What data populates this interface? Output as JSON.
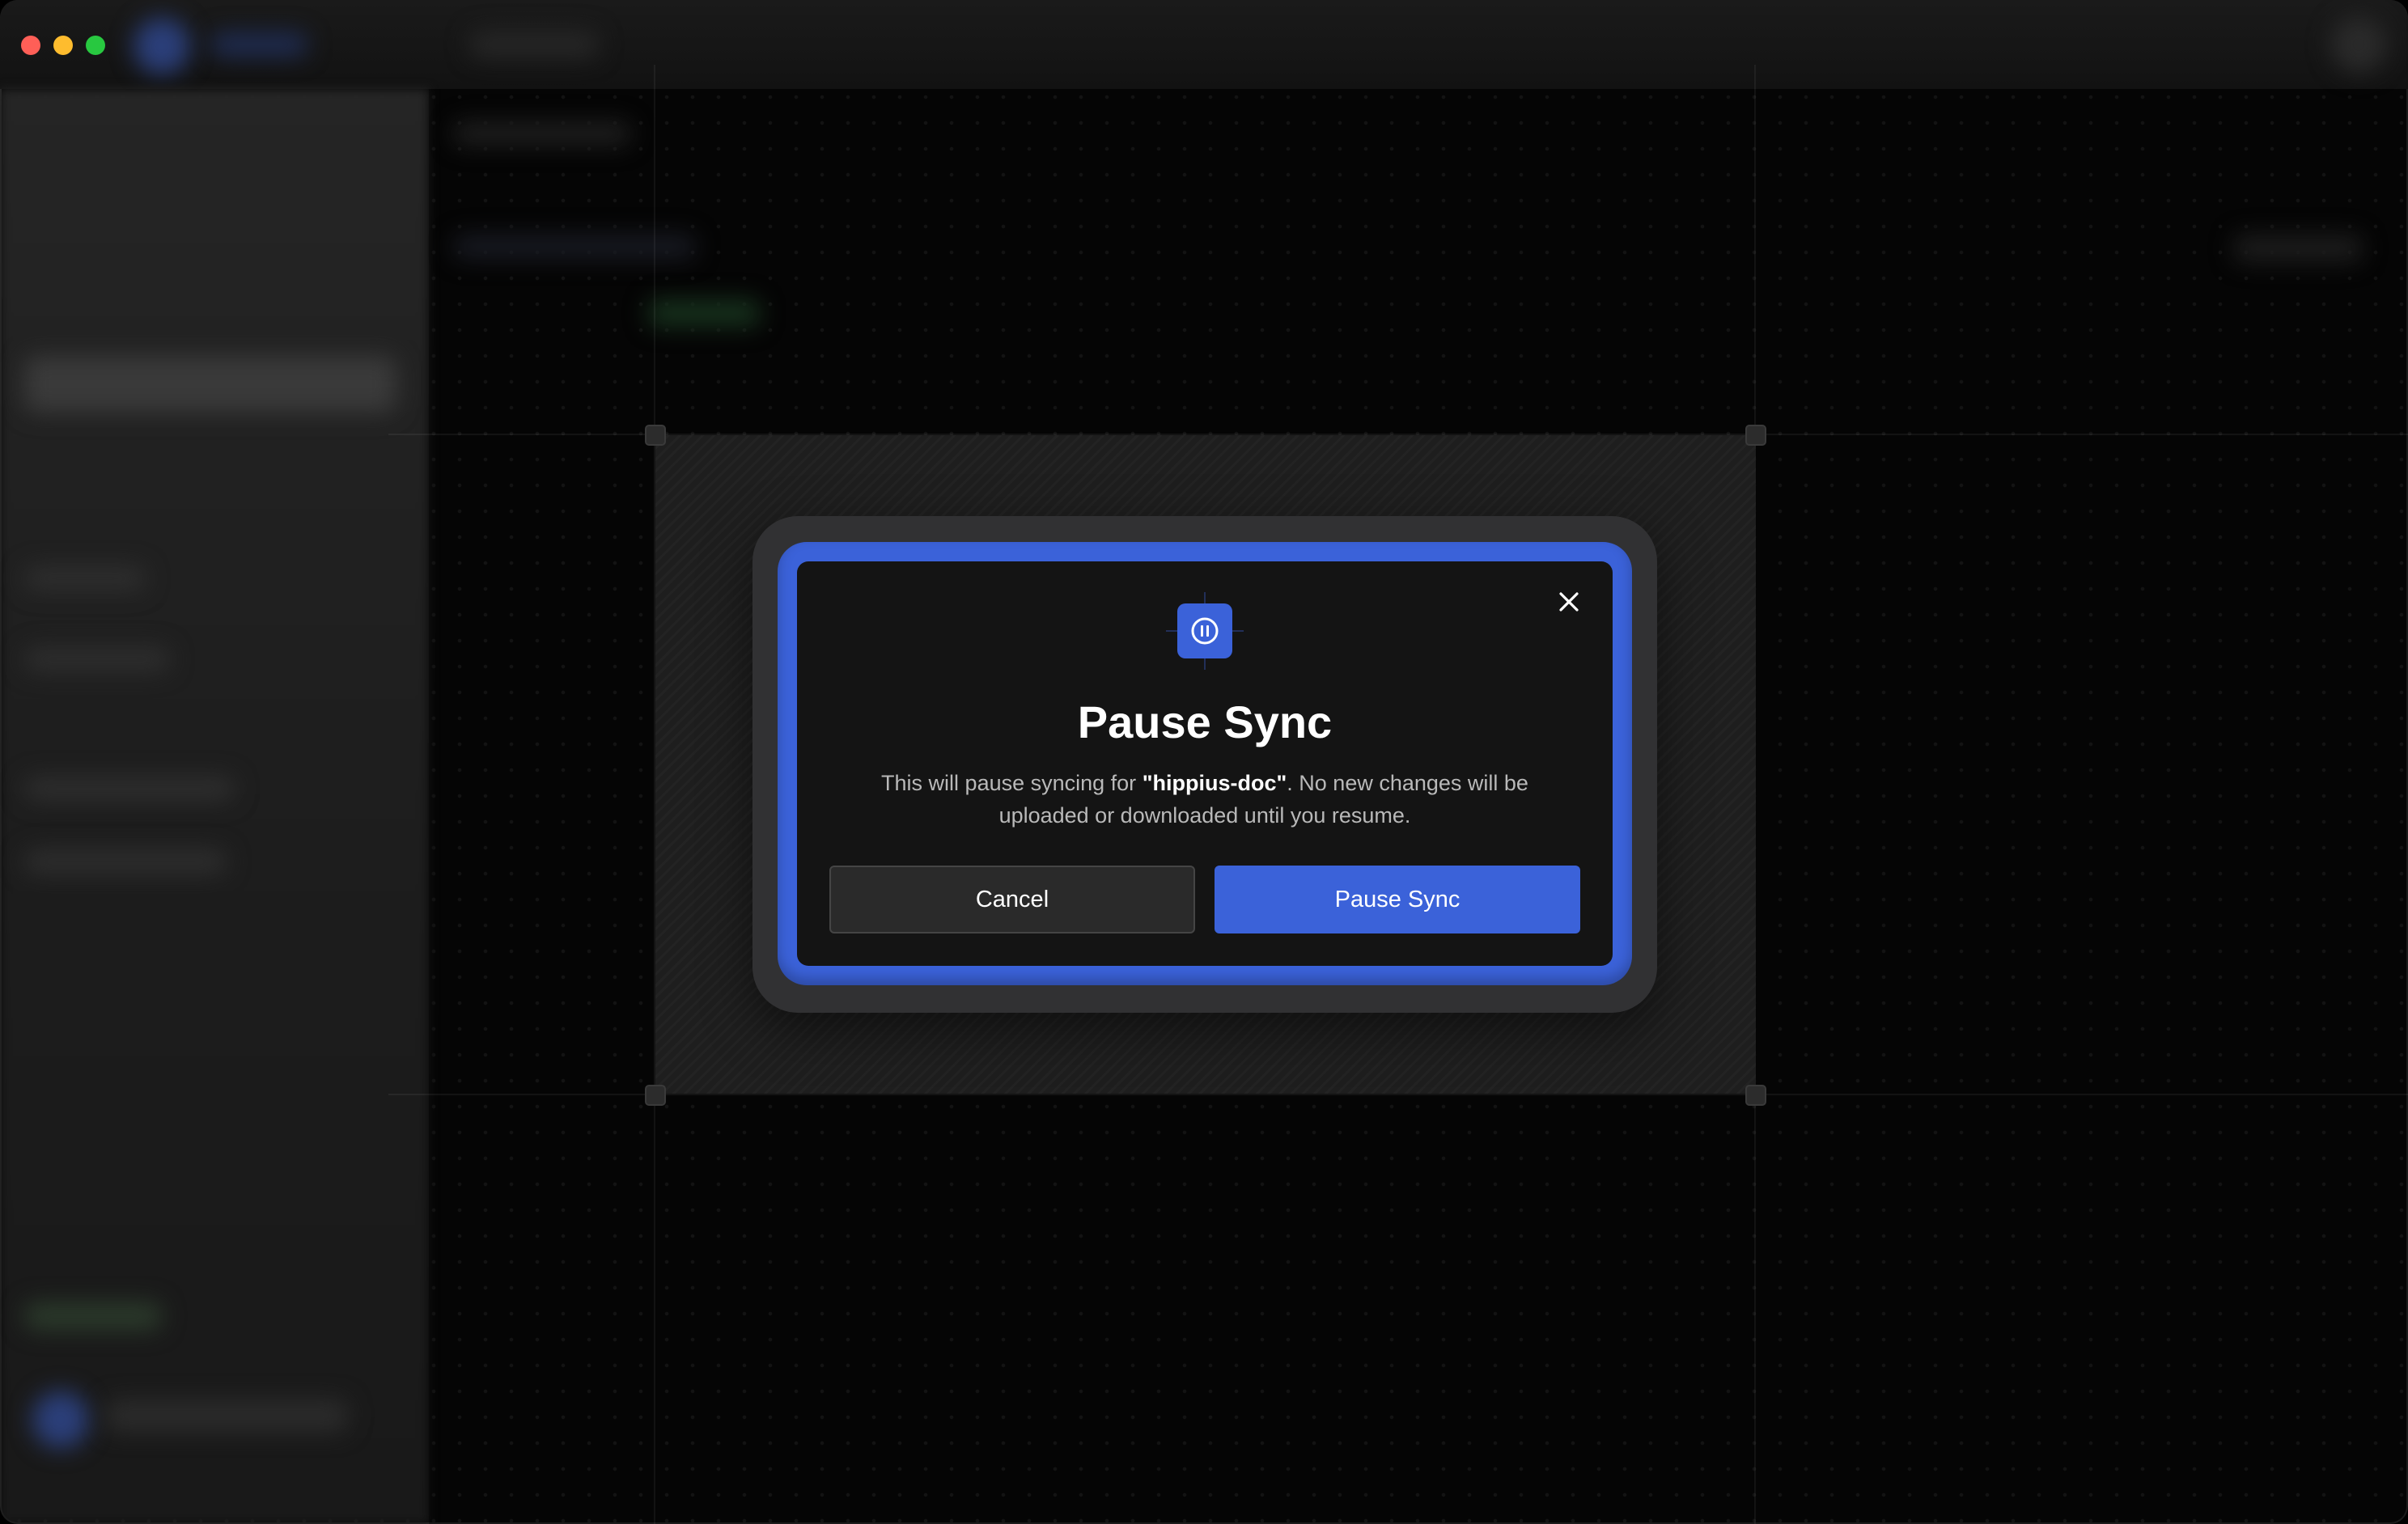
{
  "dialog": {
    "title": "Pause Sync",
    "description_prefix": "This will pause syncing for ",
    "folder_name": "\"hippius-doc\"",
    "description_suffix": ". No new changes will be uploaded or downloaded until you resume.",
    "cancel_label": "Cancel",
    "confirm_label": "Pause Sync",
    "icon": "pause-icon",
    "close_icon": "close-icon"
  },
  "colors": {
    "accent": "#3b62d9",
    "dialog_bg": "#141414",
    "frame": "#313133"
  }
}
